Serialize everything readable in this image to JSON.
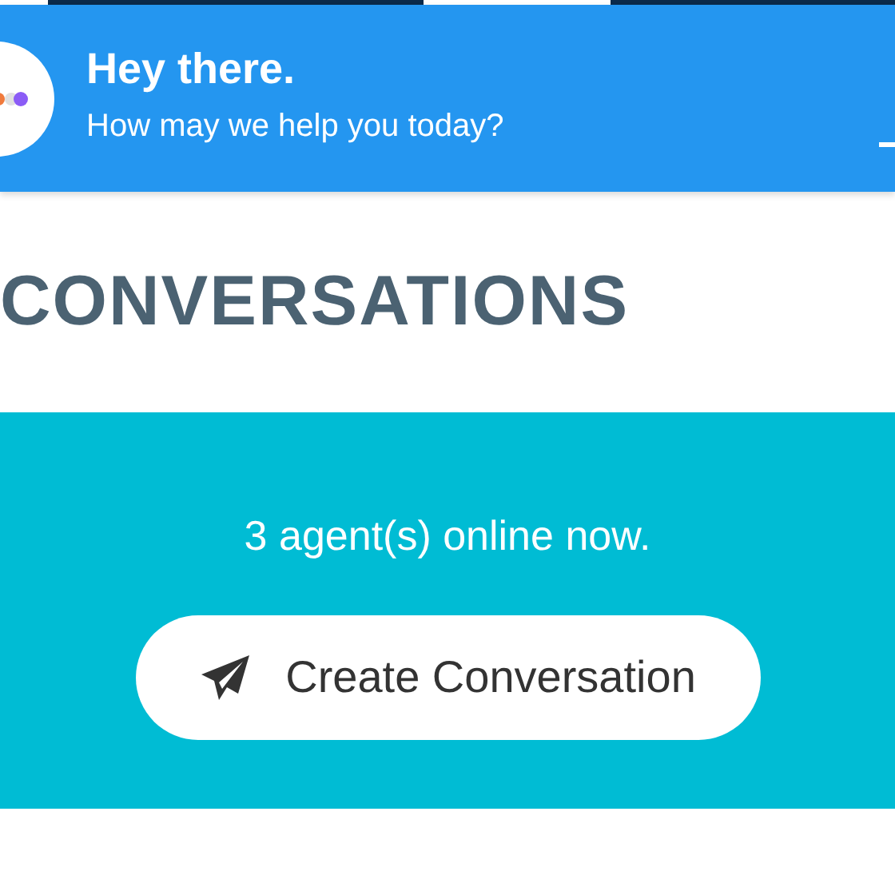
{
  "header": {
    "title": "Hey there.",
    "subtitle": "How may we help you today?"
  },
  "section_title": "CONVERSATIONS",
  "agents": {
    "status": "3 agent(s) online now.",
    "button": "Create Conversation"
  }
}
